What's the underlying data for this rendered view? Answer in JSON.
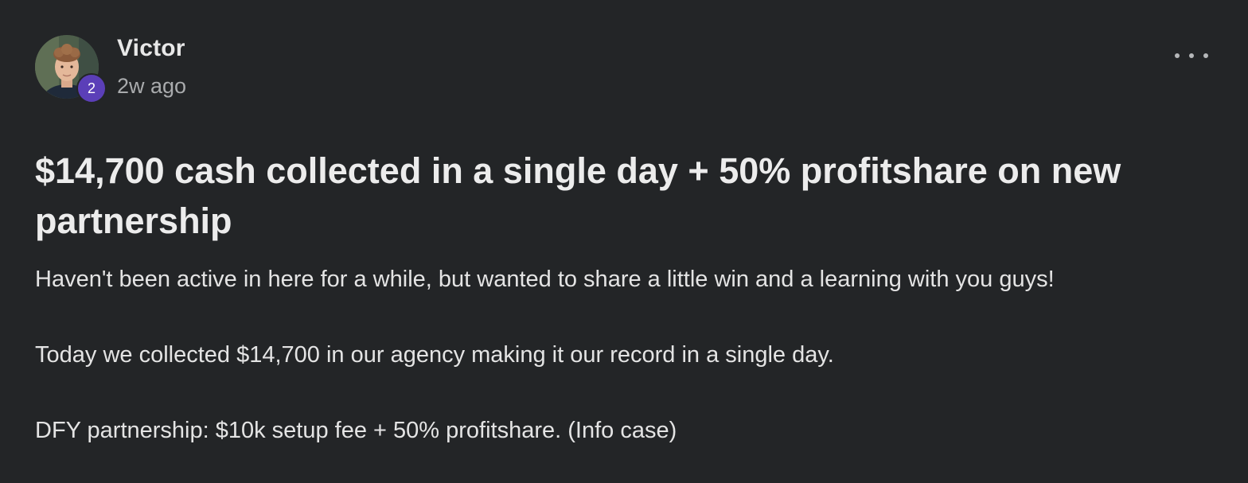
{
  "post": {
    "author": {
      "name": "Victor",
      "level": "2",
      "avatar_icon": "user-avatar-photo"
    },
    "time_ago": "2w ago",
    "more_icon": "ellipsis-icon",
    "title": "$14,700 cash collected in a single day + 50% profitshare on new partnership",
    "body": [
      "Haven't been active in here for a while, but wanted to share a little win and a learning with you guys!",
      "Today we collected $14,700 in our agency making it our record in a single day.",
      "DFY partnership: $10k setup fee + 50% profitshare. (Info case)"
    ]
  },
  "colors": {
    "background": "#232527",
    "text_primary": "#ececec",
    "text_secondary": "#a9abad",
    "level_badge": "#5b3fb8"
  }
}
